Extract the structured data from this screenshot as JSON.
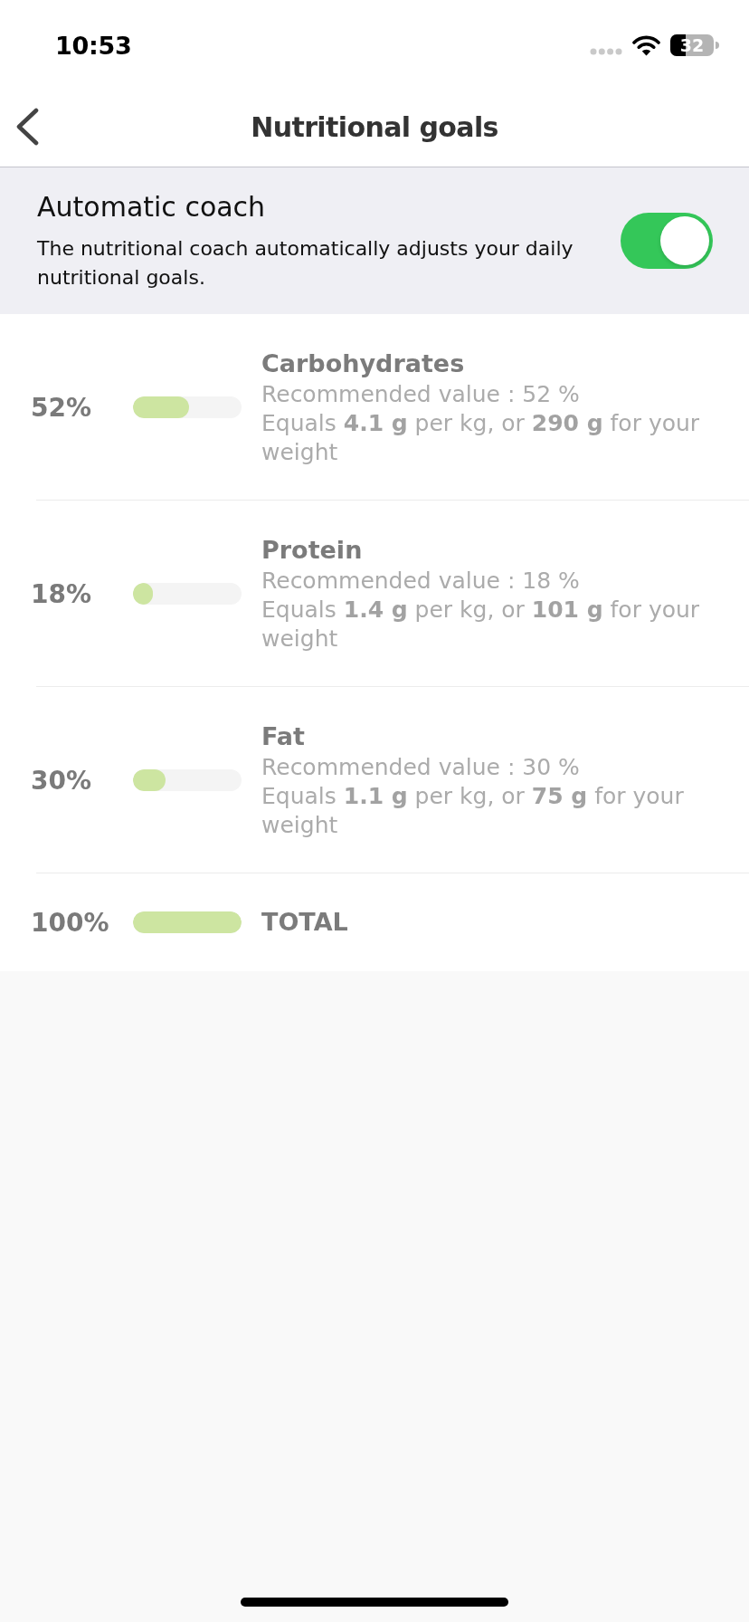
{
  "status_bar": {
    "time": "10:53",
    "battery": "32"
  },
  "nav": {
    "title": "Nutritional goals"
  },
  "coach": {
    "title": "Automatic coach",
    "description": "The nutritional coach automatically adjusts your daily nutritional goals.",
    "on": true
  },
  "macros": [
    {
      "percent": "52%",
      "level": 0.52,
      "name": "Carbohydrates",
      "recommended": "Recommended value : 52 %",
      "equivalent": "Equals **4.1 g** per kg, or **290 g** for your weight"
    },
    {
      "percent": "18%",
      "level": 0.18,
      "name": "Protein",
      "recommended": "Recommended value : 18 %",
      "equivalent": "Equals **1.4 g** per kg, or **101 g** for your weight"
    },
    {
      "percent": "30%",
      "level": 0.3,
      "name": "Fat",
      "recommended": "Recommended value : 30 %",
      "equivalent": "Equals **1.1 g** per kg, or **75 g** for your weight"
    }
  ],
  "total": {
    "percent": "100%",
    "level": 1,
    "label": "TOTAL"
  }
}
